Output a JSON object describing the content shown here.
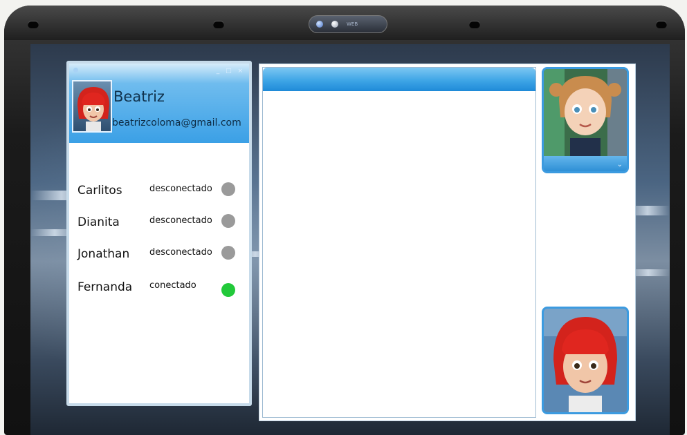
{
  "user": {
    "name": "Beatriz",
    "email": "beatrizcoloma@gmail.com"
  },
  "window_controls": "_ □ ×",
  "camera_label": "WEB",
  "contacts": [
    {
      "name": "Carlitos",
      "status": "desconectado",
      "online": false
    },
    {
      "name": "Dianita",
      "status": "desconectado",
      "online": false
    },
    {
      "name": "Jonathan",
      "status": "desconectado",
      "online": false
    },
    {
      "name": "Fernanda",
      "status": "conectado",
      "online": true
    }
  ],
  "colors": {
    "online": "#22c93a",
    "offline": "#9a9a9a",
    "accent": "#3ba0e6"
  },
  "icons": {
    "remote_video_chevron": "⌄"
  }
}
